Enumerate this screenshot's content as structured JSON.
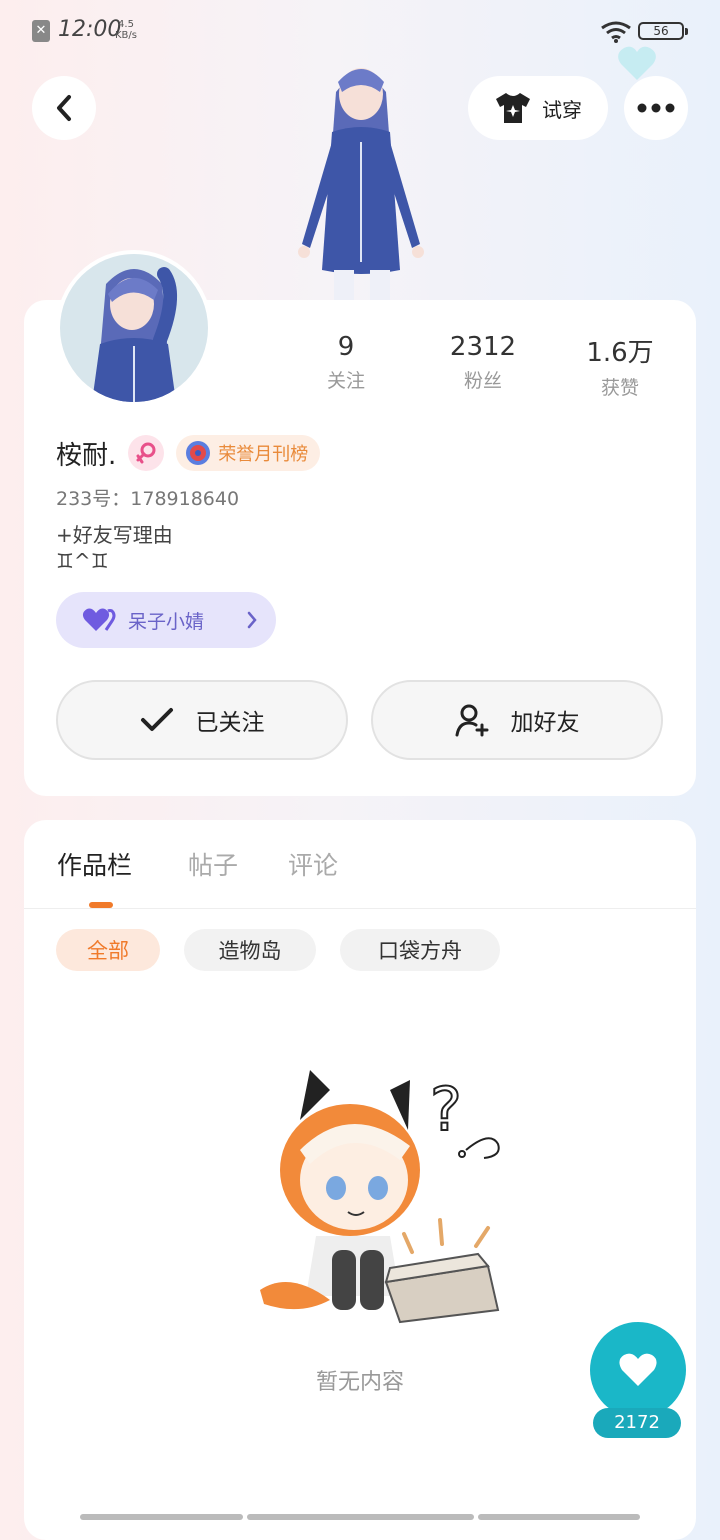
{
  "status_bar": {
    "time": "12:00",
    "net_speed_value": "4.5",
    "net_speed_unit": "KB/s",
    "battery": "56"
  },
  "top_bar": {
    "try_on_label": "试穿"
  },
  "profile": {
    "stats": [
      {
        "value": "9",
        "label": "关注"
      },
      {
        "value": "2312",
        "label": "粉丝"
      },
      {
        "value": "1.6万",
        "label": "获赞"
      }
    ],
    "username": "桉耐.",
    "gender": "female",
    "honor_badge": "荣誉月刊榜",
    "id_line": "233号：178918640",
    "bio_line1": "+好友写理由",
    "bio_line2": "♊^♊",
    "relation_label": "呆子小婧",
    "followed_label": "已关注",
    "add_friend_label": "加好友"
  },
  "tabs": [
    {
      "label": "作品栏",
      "active": true
    },
    {
      "label": "帖子",
      "active": false
    },
    {
      "label": "评论",
      "active": false
    }
  ],
  "filters": [
    {
      "label": "全部",
      "active": true
    },
    {
      "label": "造物岛",
      "active": false
    },
    {
      "label": "口袋方舟",
      "active": false
    }
  ],
  "empty_state": {
    "text": "暂无内容"
  },
  "fab": {
    "icon": "heart-icon",
    "count": "2172"
  },
  "colors": {
    "accent": "#f07a2a",
    "teal": "#1ab7c8",
    "relation_purple": "#6a63c8"
  }
}
